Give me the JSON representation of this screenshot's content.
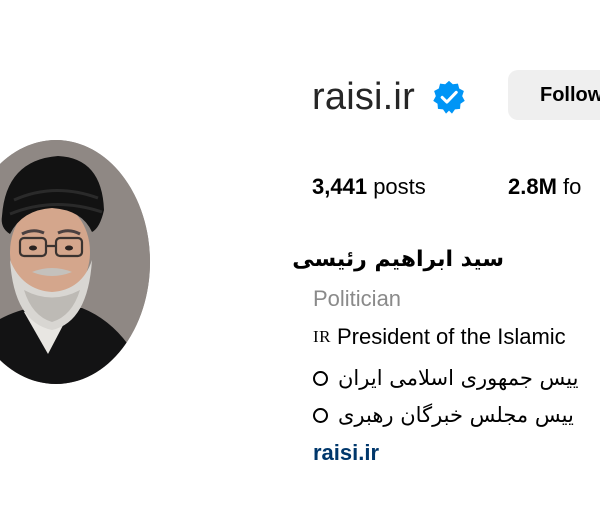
{
  "profile": {
    "username": "raisi.ir",
    "verified_icon": "verified-badge-icon",
    "follow_label": "Follow",
    "stats": {
      "posts_count": "3,441",
      "posts_label": "posts",
      "followers_count": "2.8M",
      "followers_label": "fo"
    },
    "full_name": "سید ابراهیم رئیسی",
    "category": "Politician",
    "bio_line1_flag": "IR",
    "bio_line1_text": "President of the Islamic",
    "bio_line2_text": "ییس جمهوری اسلامی ایران",
    "bio_line3_text": "ییس مجلس خبرگان رهبری",
    "website": "raisi.ir"
  },
  "colors": {
    "background": "#ffffff",
    "follow_button_bg": "#efefef",
    "verified_blue": "#0095f6",
    "link": "#00376b",
    "secondary_text": "#8a8a8a"
  }
}
